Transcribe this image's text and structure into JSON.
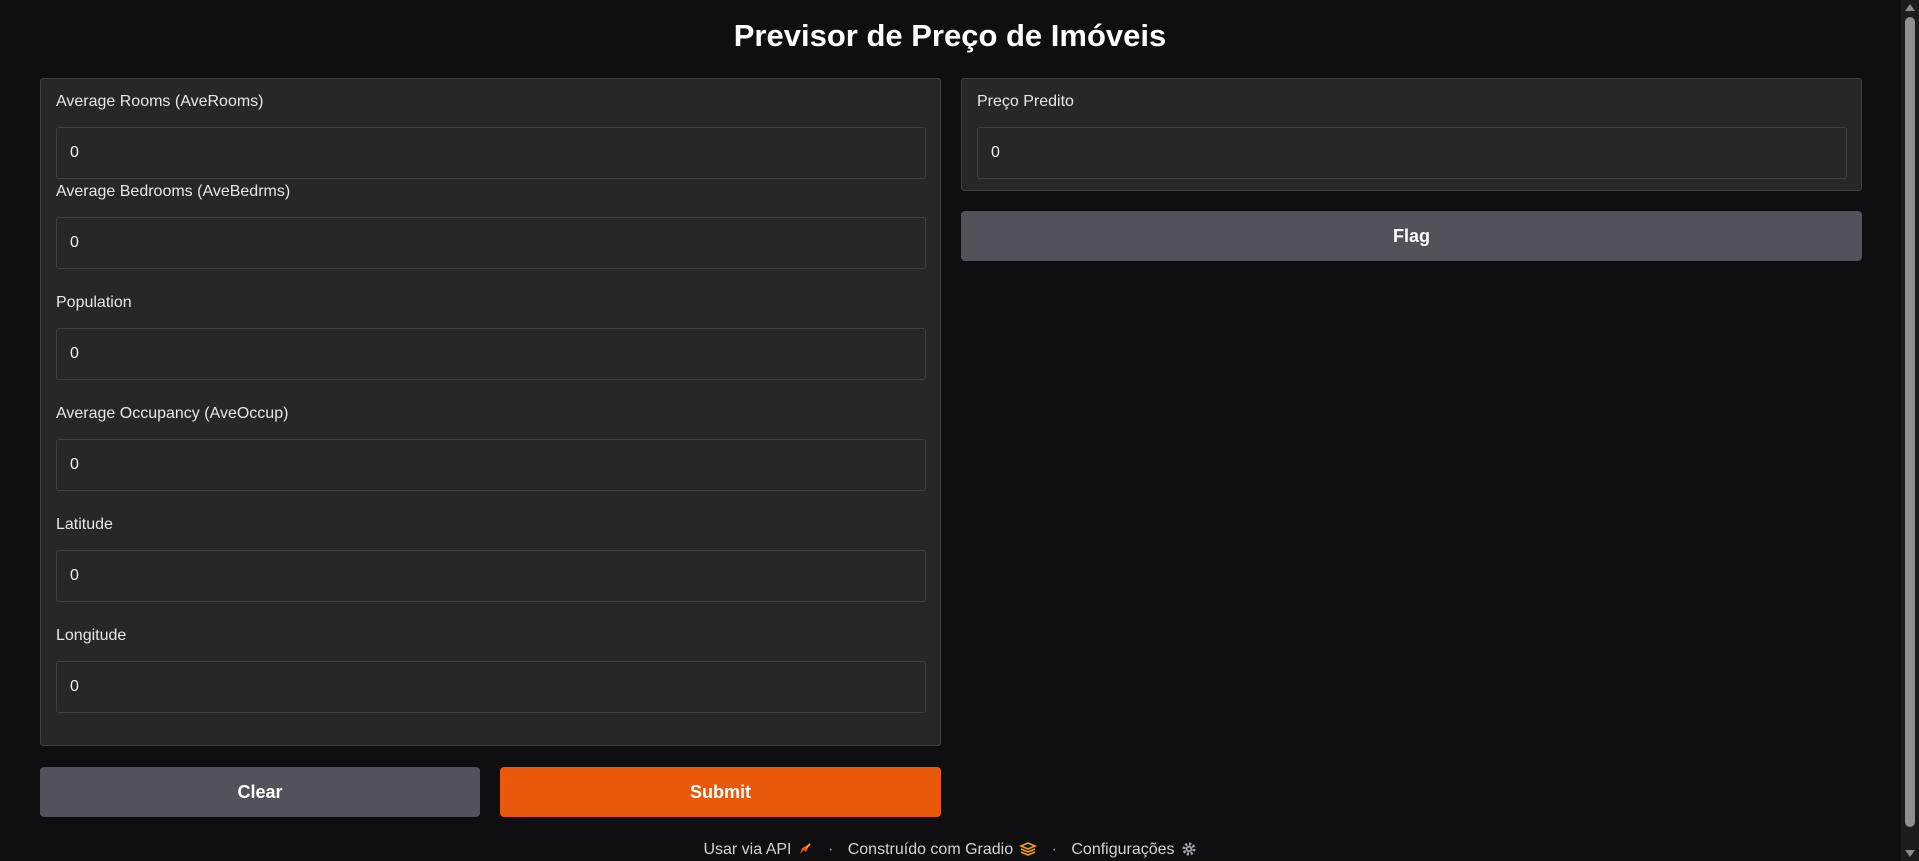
{
  "app": {
    "title": "Previsor de Preço de Imóveis"
  },
  "inputs": [
    {
      "label": "Average Rooms (AveRooms)",
      "value": "0"
    },
    {
      "label": "Average Bedrooms (AveBedrms)",
      "value": "0"
    },
    {
      "label": "Population",
      "value": "0"
    },
    {
      "label": "Average Occupancy (AveOccup)",
      "value": "0"
    },
    {
      "label": "Latitude",
      "value": "0"
    },
    {
      "label": "Longitude",
      "value": "0"
    }
  ],
  "output": {
    "label": "Preço Predito",
    "value": "0"
  },
  "buttons": {
    "clear": "Clear",
    "submit": "Submit",
    "flag": "Flag"
  },
  "footer": {
    "api": "Usar via API",
    "built_with": "Construído com Gradio",
    "settings": "Configurações",
    "separator": "·"
  },
  "colors": {
    "background": "#0f0f11",
    "panel": "#27272a",
    "primary": "#ea580c",
    "secondary": "#52525b"
  },
  "icons": {
    "api": "rocket-icon",
    "gradio": "gradio-logo-icon",
    "settings": "gear-icon"
  }
}
